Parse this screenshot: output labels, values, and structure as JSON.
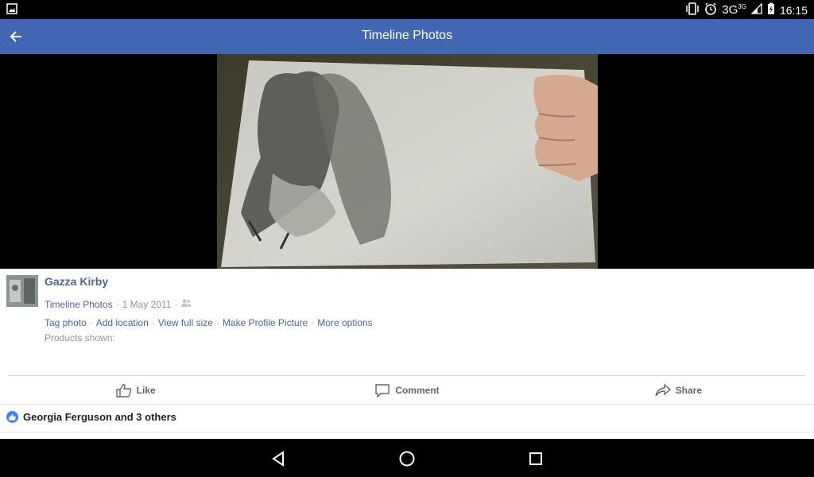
{
  "status_bar": {
    "network": "3G",
    "network_sup": "3G",
    "time": "16:15",
    "icons": [
      "image-notification-icon",
      "vibrate-icon",
      "alarm-icon",
      "signal-icon",
      "battery-charging-icon"
    ]
  },
  "app_bar": {
    "title": "Timeline Photos",
    "back_icon": "back-arrow-icon"
  },
  "post": {
    "author": "Gazza Kirby",
    "album": "Timeline Photos",
    "separator": "·",
    "date": "1 May 2011",
    "privacy_icon": "friends-icon",
    "links": [
      "Tag photo",
      "Add location",
      "View full size",
      "Make Profile Picture",
      "More options"
    ],
    "products_label": "Products shown:"
  },
  "actions": {
    "like": "Like",
    "comment": "Comment",
    "share": "Share"
  },
  "reactions": {
    "summary": "Georgia Ferguson and 3 others"
  },
  "colors": {
    "app_bar": "#4267b2",
    "link": "#4b67a1",
    "like_badge": "#4080ff"
  }
}
